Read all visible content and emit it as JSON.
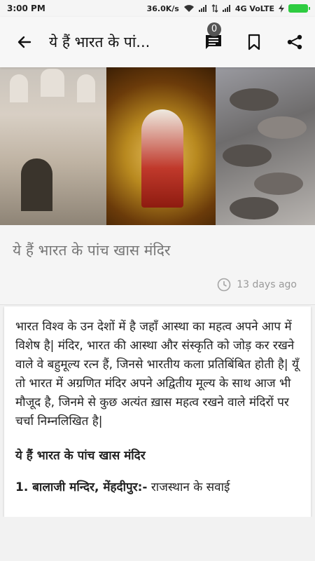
{
  "status": {
    "time": "3:00 PM",
    "speed": "36.0K/s",
    "network": "4G VoLTE"
  },
  "appbar": {
    "title": "ये हैं भारत के पां...",
    "comment_count": "0",
    "icons": [
      "back-arrow-icon",
      "comment-icon",
      "bookmark-icon",
      "share-icon"
    ]
  },
  "article": {
    "headline": "ये हैं भारत के पांच खास मंदिर",
    "date": "13 days ago",
    "intro": "भारत विश्व के उन देशों में है जहाँ आस्था का महत्व अपने आप में विशेष है| मंदिर, भारत की आस्था और संस्कृति को जोड़ कर रखने वाले वे बहुमूल्य रत्न हैं, जिनसे भारतीय कला प्रतिबिंबित होती है| यूँ तो भारत में अग्रणित मंदिर अपने अद्वितीय मूल्य के साथ आज भी मौजूद है, जिनमे से कुछ अत्यंत ख़ास महत्व रखने वाले मंदिरों पर चर्चा निम्नलिखित है|",
    "subheading": "ये हैं भारत के पांच खास मंदिर",
    "item1_title": "1. बालाजी मन्दिर, मेंहदीपुर:-",
    "item1_text": " राजस्थान के सवाई"
  },
  "colors": {
    "appbar_bg": "#f7f7f7",
    "badge_bg": "#555555",
    "text": "#222222",
    "muted": "#9a9a9a"
  }
}
